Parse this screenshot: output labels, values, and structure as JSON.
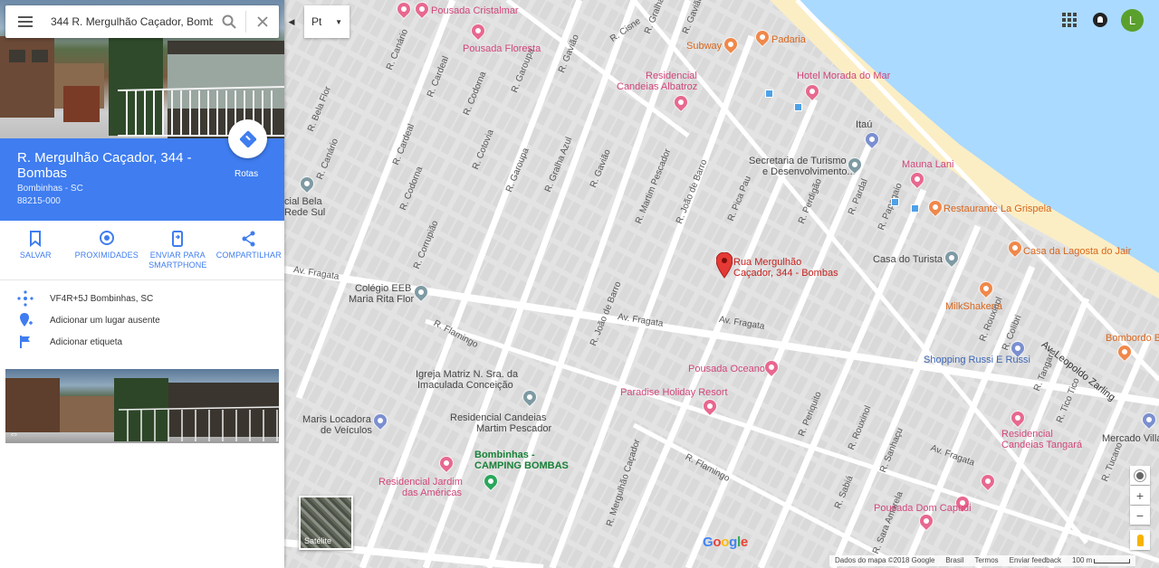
{
  "search": {
    "value": "344 R. Mergulhão Caçador, Bombas"
  },
  "language": {
    "selected": "Pt"
  },
  "place": {
    "title": "R. Mergulhão Caçador, 344 - Bombas",
    "city": "Bombinhas - SC",
    "zip": "88215-000",
    "route_label": "Rotas"
  },
  "actions": [
    {
      "label": "SALVAR",
      "icon": "bookmark-icon"
    },
    {
      "label": "PROXIMIDADES",
      "icon": "nearby-icon"
    },
    {
      "label": "ENVIAR PARA\nSMARTPHONE",
      "icon": "send-to-phone-icon"
    },
    {
      "label": "COMPARTILHAR",
      "icon": "share-icon"
    }
  ],
  "info": [
    {
      "text": "VF4R+5J Bombinhas, SC",
      "icon": "plus-code-icon"
    },
    {
      "text": "Adicionar um lugar ausente",
      "icon": "add-place-icon"
    },
    {
      "text": "Adicionar etiqueta",
      "icon": "flag-icon"
    }
  ],
  "account": {
    "initial": "L"
  },
  "satellite_label": "Satélite",
  "google_logo": "Google",
  "footer": {
    "map_data": "Dados do mapa ©2018 Google",
    "country": "Brasil",
    "terms": "Termos",
    "feedback": "Enviar feedback",
    "scale": "100 m"
  },
  "marker": {
    "line1": "Rua Mergulhão",
    "line2": "Caçador, 344 - Bombas"
  },
  "pois": {
    "pousada_cristalmar": "Pousada Cristalmar",
    "pousada_floresta": "Pousada Floresta",
    "residencial_candeias_albatroz_1": "Residencial",
    "residencial_candeias_albatroz_2": "Candeias Albatroz",
    "subway": "Subway",
    "padaria": "Padaria",
    "hotel_morada": "Hotel Morada do Mar",
    "itau": "Itaú",
    "secretaria_1": "Secretaria de Turismo",
    "secretaria_2": "e Desenvolvimento...",
    "mauna_lani": "Mauna Lani",
    "restaurante_grispela": "Restaurante La Grispela",
    "casa_lagosta": "Casa da Lagosta do Jair",
    "casa_turista": "Casa do Turista",
    "milkshakeria": "MilkShakeria",
    "shopping_russi": "Shopping Russi E Russi",
    "bombordo": "Bombordo B",
    "mercado": "Mercado Villa",
    "residencial_tangara_1": "Residencial",
    "residencial_tangara_2": "Candeias Tangará",
    "pousada_dom_capudi": "Pousada Dom Capudi",
    "pousada_oceano": "Pousada Oceano",
    "paradise": "Paradise Holiday Resort",
    "igreja_1": "Igreja Matriz N. Sra. da",
    "igreja_2": "Imaculada Conceição",
    "res_martim_1": "Residencial Candeias",
    "res_martim_2": "Martim Pescador",
    "maris_1": "Maris Locadora",
    "maris_2": "de Veículos",
    "camping_1": "Bombinhas -",
    "camping_2": "CAMPING BOMBAS",
    "res_jardim_1": "Residencial Jardim",
    "res_jardim_2": "das Américas",
    "colegio_1": "Colégio EEB",
    "colegio_2": "Maria Rita Flor",
    "cial_bela_1": "cial Bela",
    "cial_bela_2": "Rede Sul"
  },
  "streets": {
    "bela_flor": "R. Bela Flor",
    "canario": "R. Canário",
    "cardeal": "R. Cardeal",
    "codorna": "R. Codorna",
    "cotovia": "R. Cotovia",
    "garoupa": "R. Garoupa",
    "gralha_azul": "R. Gralha Azul",
    "gaviao": "R. Gavião",
    "cisne": "R. Cisne",
    "gralha": "R. Gralha",
    "martim_pescador": "R. Martim Pescador",
    "joao_de_barro": "R. João de Barro",
    "pica_pau": "R. Pica Pau",
    "perdigao": "R. Perdigão",
    "pardal": "R. Pardal",
    "papagaio": "R. Papagaio",
    "corrupiao": "R. Corrupião",
    "fragata": "Av. Fragata",
    "flamingo": "R. Flamingo",
    "leopoldo": "Av. Leopoldo Zarling",
    "rouxinol": "R. Rouxinol",
    "sabia": "R. Sabiá",
    "periquito": "R. Periquito",
    "sanhacu": "R. Sanhaçu",
    "tangara": "R. Tangará",
    "tico_tico": "R. Tico Tico",
    "tucano": "R. Tucano",
    "colibri": "R. Colibri",
    "sara_amarela": "R. Sara Amarela",
    "mergulhao": "R. Mergulhão Caçador",
    "pintassilgo": "R. Pintassilgo",
    "gralha_garnizo": "R. Galo Garnizé",
    "pelicano": "R. Pelicano",
    "perdiz": "R. Perdiz",
    "bem_te_vi": "R. Bem-te-vi"
  }
}
